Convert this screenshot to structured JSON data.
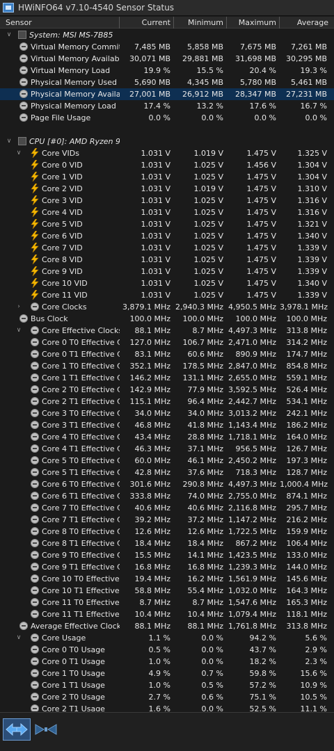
{
  "window": {
    "title": "HWiNFO64 v7.10-4540 Sensor Status"
  },
  "columns": {
    "sensor": "Sensor",
    "current": "Current",
    "minimum": "Minimum",
    "maximum": "Maximum",
    "average": "Average"
  },
  "rows": [
    {
      "t": "group",
      "indent": 0,
      "chev": "v",
      "icon": "sys",
      "name": "System: MSI MS-7B85"
    },
    {
      "t": "sensor",
      "indent": 1,
      "icon": "circle",
      "name": "Virtual Memory Committed",
      "cur": "7,485 MB",
      "min": "5,858 MB",
      "max": "7,675 MB",
      "avg": "7,261 MB"
    },
    {
      "t": "sensor",
      "indent": 1,
      "icon": "circle",
      "name": "Virtual Memory Available",
      "cur": "30,071 MB",
      "min": "29,881 MB",
      "max": "31,698 MB",
      "avg": "30,295 MB"
    },
    {
      "t": "sensor",
      "indent": 1,
      "icon": "circle",
      "name": "Virtual Memory Load",
      "cur": "19.9 %",
      "min": "15.5 %",
      "max": "20.4 %",
      "avg": "19.3 %"
    },
    {
      "t": "sensor",
      "indent": 1,
      "icon": "circle",
      "name": "Physical Memory Used",
      "cur": "5,690 MB",
      "min": "4,345 MB",
      "max": "5,780 MB",
      "avg": "5,461 MB"
    },
    {
      "t": "sensor",
      "indent": 1,
      "icon": "circle",
      "name": "Physical Memory Available",
      "cur": "27,001 MB",
      "min": "26,912 MB",
      "max": "28,347 MB",
      "avg": "27,231 MB",
      "hl": "sel"
    },
    {
      "t": "sensor",
      "indent": 1,
      "icon": "circle",
      "name": "Physical Memory Load",
      "cur": "17.4 %",
      "min": "13.2 %",
      "max": "17.6 %",
      "avg": "16.7 %"
    },
    {
      "t": "sensor",
      "indent": 1,
      "icon": "circle",
      "name": "Page File Usage",
      "cur": "0.0 %",
      "min": "0.0 %",
      "max": "0.0 %",
      "avg": "0.0 %"
    },
    {
      "t": "gap"
    },
    {
      "t": "group",
      "indent": 0,
      "chev": "v",
      "icon": "sys",
      "name": "CPU [#0]: AMD Ryzen 9 ..."
    },
    {
      "t": "sensor",
      "indent": 2,
      "chev": "v",
      "icon": "bolt",
      "name": "Core VIDs",
      "cur": "1.031 V",
      "min": "1.019 V",
      "max": "1.475 V",
      "avg": "1.325 V"
    },
    {
      "t": "sensor",
      "indent": 2,
      "icon": "bolt",
      "name": "Core 0 VID",
      "cur": "1.031 V",
      "min": "1.025 V",
      "max": "1.456 V",
      "avg": "1.304 V"
    },
    {
      "t": "sensor",
      "indent": 2,
      "icon": "bolt",
      "name": "Core 1 VID",
      "cur": "1.031 V",
      "min": "1.025 V",
      "max": "1.475 V",
      "avg": "1.304 V"
    },
    {
      "t": "sensor",
      "indent": 2,
      "icon": "bolt",
      "name": "Core 2 VID",
      "cur": "1.031 V",
      "min": "1.019 V",
      "max": "1.475 V",
      "avg": "1.310 V"
    },
    {
      "t": "sensor",
      "indent": 2,
      "icon": "bolt",
      "name": "Core 3 VID",
      "cur": "1.031 V",
      "min": "1.025 V",
      "max": "1.475 V",
      "avg": "1.316 V"
    },
    {
      "t": "sensor",
      "indent": 2,
      "icon": "bolt",
      "name": "Core 4 VID",
      "cur": "1.031 V",
      "min": "1.025 V",
      "max": "1.475 V",
      "avg": "1.316 V"
    },
    {
      "t": "sensor",
      "indent": 2,
      "icon": "bolt",
      "name": "Core 5 VID",
      "cur": "1.031 V",
      "min": "1.025 V",
      "max": "1.475 V",
      "avg": "1.321 V"
    },
    {
      "t": "sensor",
      "indent": 2,
      "icon": "bolt",
      "name": "Core 6 VID",
      "cur": "1.031 V",
      "min": "1.025 V",
      "max": "1.475 V",
      "avg": "1.340 V"
    },
    {
      "t": "sensor",
      "indent": 2,
      "icon": "bolt",
      "name": "Core 7 VID",
      "cur": "1.031 V",
      "min": "1.025 V",
      "max": "1.475 V",
      "avg": "1.339 V"
    },
    {
      "t": "sensor",
      "indent": 2,
      "icon": "bolt",
      "name": "Core 8 VID",
      "cur": "1.031 V",
      "min": "1.025 V",
      "max": "1.475 V",
      "avg": "1.339 V"
    },
    {
      "t": "sensor",
      "indent": 2,
      "icon": "bolt",
      "name": "Core 9 VID",
      "cur": "1.031 V",
      "min": "1.025 V",
      "max": "1.475 V",
      "avg": "1.339 V"
    },
    {
      "t": "sensor",
      "indent": 2,
      "icon": "bolt",
      "name": "Core 10 VID",
      "cur": "1.031 V",
      "min": "1.025 V",
      "max": "1.475 V",
      "avg": "1.340 V"
    },
    {
      "t": "sensor",
      "indent": 2,
      "icon": "bolt",
      "name": "Core 11 VID",
      "cur": "1.031 V",
      "min": "1.025 V",
      "max": "1.475 V",
      "avg": "1.339 V"
    },
    {
      "t": "sensor",
      "indent": 2,
      "chev": ">",
      "icon": "circle",
      "name": "Core Clocks",
      "cur": "3,879.1 MHz",
      "min": "2,940.3 MHz",
      "max": "4,950.5 MHz",
      "avg": "3,978.1 MHz"
    },
    {
      "t": "sensor",
      "indent": 1,
      "icon": "circle",
      "name": "Bus Clock",
      "cur": "100.0 MHz",
      "min": "100.0 MHz",
      "max": "100.0 MHz",
      "avg": "100.0 MHz"
    },
    {
      "t": "sensor",
      "indent": 2,
      "chev": "v",
      "icon": "circle",
      "name": "Core Effective Clocks",
      "cur": "88.1 MHz",
      "min": "8.7 MHz",
      "max": "4,497.3 MHz",
      "avg": "313.8 MHz"
    },
    {
      "t": "sensor",
      "indent": 3,
      "icon": "circle",
      "name": "Core 0 T0 Effective C...",
      "cur": "127.0 MHz",
      "min": "106.7 MHz",
      "max": "2,471.0 MHz",
      "avg": "314.2 MHz"
    },
    {
      "t": "sensor",
      "indent": 3,
      "icon": "circle",
      "name": "Core 0 T1 Effective C...",
      "cur": "83.1 MHz",
      "min": "60.6 MHz",
      "max": "890.9 MHz",
      "avg": "174.7 MHz"
    },
    {
      "t": "sensor",
      "indent": 3,
      "icon": "circle",
      "name": "Core 1 T0 Effective C...",
      "cur": "352.1 MHz",
      "min": "178.5 MHz",
      "max": "2,847.0 MHz",
      "avg": "854.8 MHz"
    },
    {
      "t": "sensor",
      "indent": 3,
      "icon": "circle",
      "name": "Core 1 T1 Effective C...",
      "cur": "146.2 MHz",
      "min": "131.1 MHz",
      "max": "2,655.0 MHz",
      "avg": "559.1 MHz"
    },
    {
      "t": "sensor",
      "indent": 3,
      "icon": "circle",
      "name": "Core 2 T0 Effective C...",
      "cur": "142.9 MHz",
      "min": "77.9 MHz",
      "max": "3,592.5 MHz",
      "avg": "526.4 MHz"
    },
    {
      "t": "sensor",
      "indent": 3,
      "icon": "circle",
      "name": "Core 2 T1 Effective C...",
      "cur": "115.1 MHz",
      "min": "96.4 MHz",
      "max": "2,442.7 MHz",
      "avg": "534.1 MHz"
    },
    {
      "t": "sensor",
      "indent": 3,
      "icon": "circle",
      "name": "Core 3 T0 Effective C...",
      "cur": "34.0 MHz",
      "min": "34.0 MHz",
      "max": "3,013.2 MHz",
      "avg": "242.1 MHz"
    },
    {
      "t": "sensor",
      "indent": 3,
      "icon": "circle",
      "name": "Core 3 T1 Effective C...",
      "cur": "46.8 MHz",
      "min": "41.8 MHz",
      "max": "1,143.4 MHz",
      "avg": "186.2 MHz"
    },
    {
      "t": "sensor",
      "indent": 3,
      "icon": "circle",
      "name": "Core 4 T0 Effective C...",
      "cur": "43.4 MHz",
      "min": "28.8 MHz",
      "max": "1,718.1 MHz",
      "avg": "164.0 MHz"
    },
    {
      "t": "sensor",
      "indent": 3,
      "icon": "circle",
      "name": "Core 4 T1 Effective C...",
      "cur": "46.3 MHz",
      "min": "37.1 MHz",
      "max": "956.5 MHz",
      "avg": "126.7 MHz"
    },
    {
      "t": "sensor",
      "indent": 3,
      "icon": "circle",
      "name": "Core 5 T0 Effective C...",
      "cur": "60.0 MHz",
      "min": "46.1 MHz",
      "max": "2,450.2 MHz",
      "avg": "197.3 MHz"
    },
    {
      "t": "sensor",
      "indent": 3,
      "icon": "circle",
      "name": "Core 5 T1 Effective C...",
      "cur": "42.8 MHz",
      "min": "37.6 MHz",
      "max": "718.3 MHz",
      "avg": "128.7 MHz"
    },
    {
      "t": "sensor",
      "indent": 3,
      "icon": "circle",
      "name": "Core 6 T0 Effective C...",
      "cur": "301.6 MHz",
      "min": "290.8 MHz",
      "max": "4,497.3 MHz",
      "avg": "1,000.4 MHz"
    },
    {
      "t": "sensor",
      "indent": 3,
      "icon": "circle",
      "name": "Core 6 T1 Effective C...",
      "cur": "333.8 MHz",
      "min": "74.0 MHz",
      "max": "2,755.0 MHz",
      "avg": "874.1 MHz"
    },
    {
      "t": "sensor",
      "indent": 3,
      "icon": "circle",
      "name": "Core 7 T0 Effective C...",
      "cur": "40.6 MHz",
      "min": "40.6 MHz",
      "max": "2,116.8 MHz",
      "avg": "295.7 MHz"
    },
    {
      "t": "sensor",
      "indent": 3,
      "icon": "circle",
      "name": "Core 7 T1 Effective C...",
      "cur": "39.2 MHz",
      "min": "37.2 MHz",
      "max": "1,147.2 MHz",
      "avg": "216.2 MHz"
    },
    {
      "t": "sensor",
      "indent": 3,
      "icon": "circle",
      "name": "Core 8 T0 Effective C...",
      "cur": "12.6 MHz",
      "min": "12.6 MHz",
      "max": "1,722.5 MHz",
      "avg": "159.9 MHz"
    },
    {
      "t": "sensor",
      "indent": 3,
      "icon": "circle",
      "name": "Core 8 T1 Effective C...",
      "cur": "18.4 MHz",
      "min": "18.4 MHz",
      "max": "867.2 MHz",
      "avg": "106.4 MHz"
    },
    {
      "t": "sensor",
      "indent": 3,
      "icon": "circle",
      "name": "Core 9 T0 Effective C...",
      "cur": "15.5 MHz",
      "min": "14.1 MHz",
      "max": "1,423.5 MHz",
      "avg": "133.0 MHz"
    },
    {
      "t": "sensor",
      "indent": 3,
      "icon": "circle",
      "name": "Core 9 T1 Effective C...",
      "cur": "16.8 MHz",
      "min": "16.8 MHz",
      "max": "1,239.3 MHz",
      "avg": "144.0 MHz"
    },
    {
      "t": "sensor",
      "indent": 3,
      "icon": "circle",
      "name": "Core 10 T0 Effective ...",
      "cur": "19.4 MHz",
      "min": "16.2 MHz",
      "max": "1,561.9 MHz",
      "avg": "145.6 MHz"
    },
    {
      "t": "sensor",
      "indent": 3,
      "icon": "circle",
      "name": "Core 10 T1 Effective ...",
      "cur": "58.8 MHz",
      "min": "55.4 MHz",
      "max": "1,032.0 MHz",
      "avg": "164.3 MHz"
    },
    {
      "t": "sensor",
      "indent": 3,
      "icon": "circle",
      "name": "Core 11 T0 Effective ...",
      "cur": "8.7 MHz",
      "min": "8.7 MHz",
      "max": "1,547.6 MHz",
      "avg": "165.3 MHz"
    },
    {
      "t": "sensor",
      "indent": 3,
      "icon": "circle",
      "name": "Core 11 T1 Effective ...",
      "cur": "10.4 MHz",
      "min": "10.4 MHz",
      "max": "1,079.4 MHz",
      "avg": "118.1 MHz"
    },
    {
      "t": "sensor",
      "indent": 1,
      "icon": "circle",
      "name": "Average Effective Clock",
      "cur": "88.1 MHz",
      "min": "88.1 MHz",
      "max": "1,761.8 MHz",
      "avg": "313.8 MHz"
    },
    {
      "t": "sensor",
      "indent": 2,
      "chev": "v",
      "icon": "circle",
      "name": "Core Usage",
      "cur": "1.1 %",
      "min": "0.0 %",
      "max": "94.2 %",
      "avg": "5.6 %"
    },
    {
      "t": "sensor",
      "indent": 3,
      "icon": "circle",
      "name": "Core 0 T0 Usage",
      "cur": "0.5 %",
      "min": "0.0 %",
      "max": "43.7 %",
      "avg": "2.9 %"
    },
    {
      "t": "sensor",
      "indent": 3,
      "icon": "circle",
      "name": "Core 0 T1 Usage",
      "cur": "1.0 %",
      "min": "0.0 %",
      "max": "18.2 %",
      "avg": "2.3 %"
    },
    {
      "t": "sensor",
      "indent": 3,
      "icon": "circle",
      "name": "Core 1 T0 Usage",
      "cur": "4.9 %",
      "min": "0.7 %",
      "max": "59.8 %",
      "avg": "15.6 %"
    },
    {
      "t": "sensor",
      "indent": 3,
      "icon": "circle",
      "name": "Core 1 T1 Usage",
      "cur": "1.0 %",
      "min": "0.5 %",
      "max": "57.2 %",
      "avg": "10.9 %"
    },
    {
      "t": "sensor",
      "indent": 3,
      "icon": "circle",
      "name": "Core 2 T0 Usage",
      "cur": "2.7 %",
      "min": "0.6 %",
      "max": "75.1 %",
      "avg": "10.5 %"
    },
    {
      "t": "sensor",
      "indent": 3,
      "icon": "circle",
      "name": "Core 2 T1 Usage",
      "cur": "1.6 %",
      "min": "0.0 %",
      "max": "52.5 %",
      "avg": "11.1 %"
    }
  ],
  "icons": {
    "group": "chip-icon",
    "sensor": "sensor-icon",
    "bolt": "voltage-icon"
  },
  "footer": {
    "nav_button": "double-arrow-icon",
    "layout_button": "collapse-arrows-icon"
  },
  "colors": {
    "selection": "#0e2f52",
    "background": "#1b1b1b",
    "bolt": "#f5b800"
  }
}
